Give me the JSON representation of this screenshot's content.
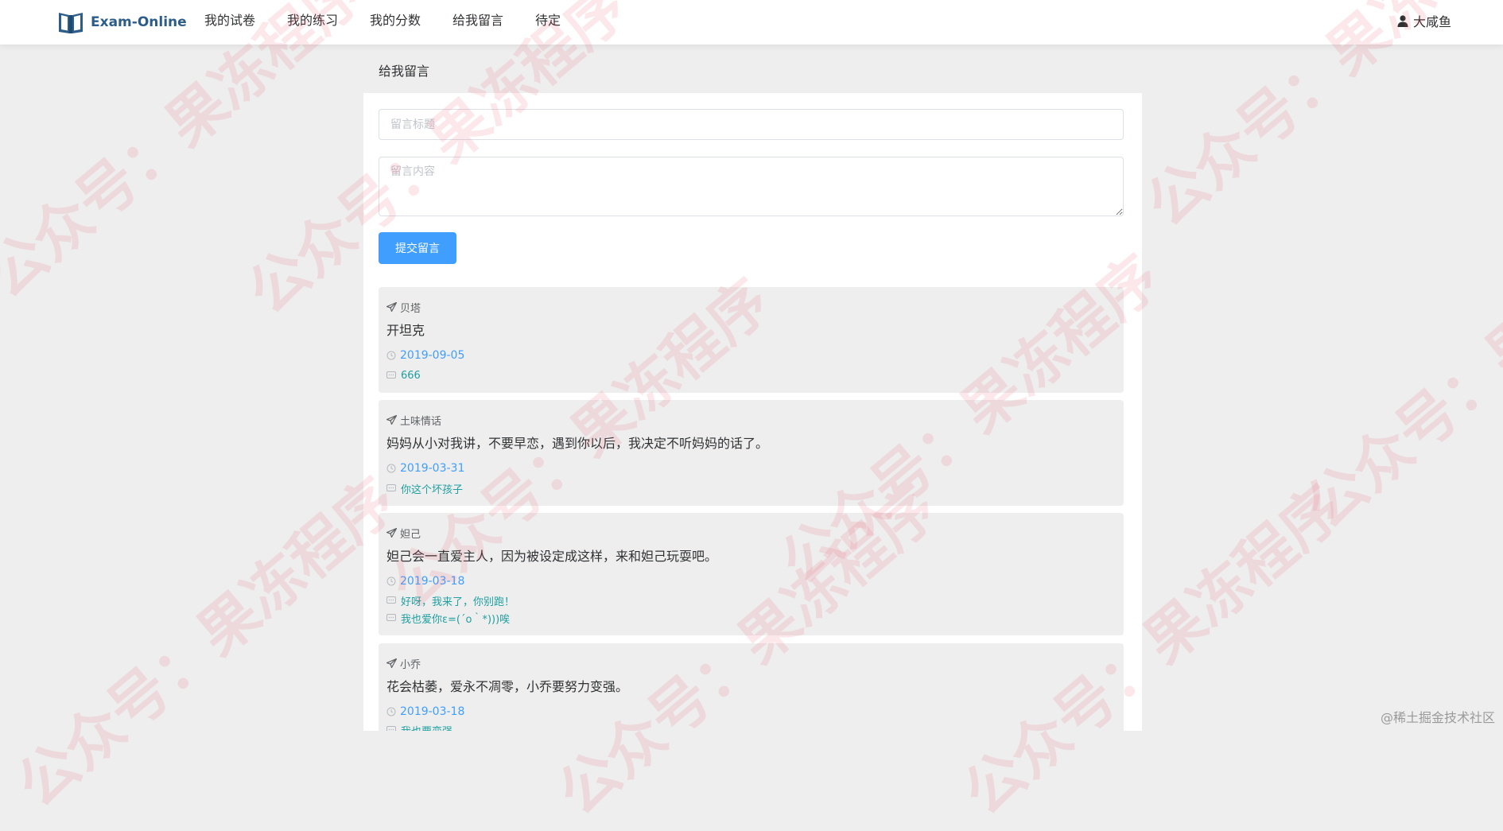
{
  "header": {
    "brand": "Exam-Online",
    "nav": [
      "我的试卷",
      "我的练习",
      "我的分数",
      "给我留言",
      "待定"
    ],
    "user": "大咸鱼"
  },
  "page": {
    "title": "给我留言",
    "title_placeholder": "留言标题",
    "content_placeholder": "留言内容",
    "submit_label": "提交留言"
  },
  "messages": [
    {
      "author": "贝塔",
      "content": "开坦克",
      "date": "2019-09-05",
      "replies": [
        "666"
      ]
    },
    {
      "author": "土味情话",
      "content": "妈妈从小对我讲，不要早恋，遇到你以后，我决定不听妈妈的话了。",
      "date": "2019-03-31",
      "replies": [
        "你这个坏孩子"
      ]
    },
    {
      "author": "妲己",
      "content": "妲己会一直爱主人，因为被设定成这样，来和妲己玩耍吧。",
      "date": "2019-03-18",
      "replies": [
        "好呀，我来了，你别跑！",
        "我也爱你ε=(´ο｀*)))唉"
      ]
    },
    {
      "author": "小乔",
      "content": "花会枯萎，爱永不凋零，小乔要努力变强。",
      "date": "2019-03-18",
      "replies": [
        "我也要变强"
      ]
    }
  ],
  "watermark": {
    "text": "公众号：果冻程序",
    "footer": "@稀土掘金技术社区"
  },
  "colors": {
    "primary": "#409eff",
    "reply": "#20a0a0",
    "brand": "#2c5d8a",
    "background": "#eeeeee"
  }
}
